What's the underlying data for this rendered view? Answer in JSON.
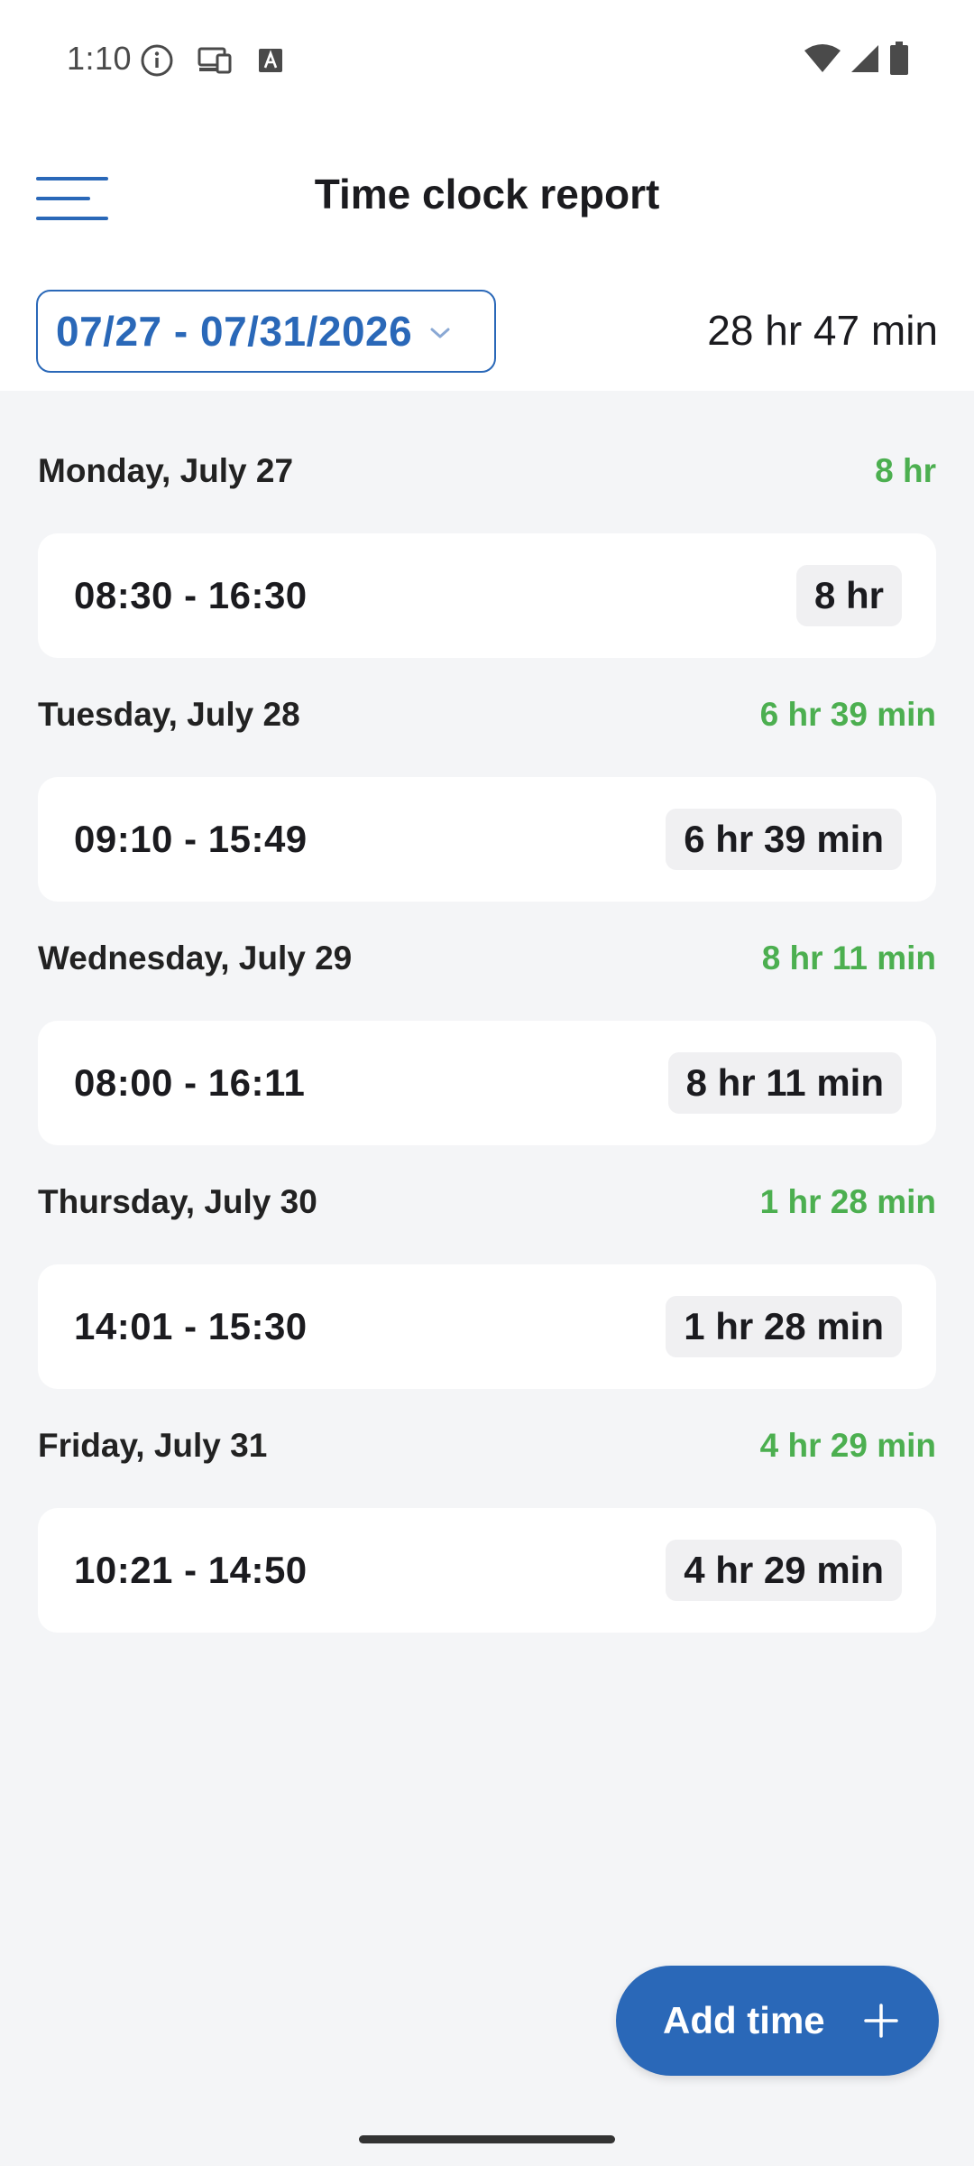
{
  "status_bar": {
    "time": "1:10",
    "left_icons": [
      "info-icon",
      "devices-icon",
      "text-a-icon"
    ],
    "right_icons": [
      "wifi-icon",
      "signal-icon",
      "battery-icon"
    ]
  },
  "header": {
    "title": "Time clock report",
    "menu_icon": "hamburger-menu-icon"
  },
  "range": {
    "label": "07/27 - 07/31/2026",
    "total": "28 hr 47 min"
  },
  "days": [
    {
      "label": "Monday, July 27",
      "total": "8 hr",
      "entry_range": "08:30 - 16:30",
      "entry_duration": "8 hr"
    },
    {
      "label": "Tuesday, July 28",
      "total": "6 hr 39 min",
      "entry_range": "09:10 - 15:49",
      "entry_duration": "6 hr 39 min"
    },
    {
      "label": "Wednesday, July 29",
      "total": "8 hr 11 min",
      "entry_range": "08:00 - 16:11",
      "entry_duration": "8 hr 11 min"
    },
    {
      "label": "Thursday, July 30",
      "total": "1 hr 28 min",
      "entry_range": "14:01 - 15:30",
      "entry_duration": "1 hr 28 min"
    },
    {
      "label": "Friday, July 31",
      "total": "4 hr 29 min",
      "entry_range": "10:21 - 14:50",
      "entry_duration": "4 hr 29 min"
    }
  ],
  "fab": {
    "label": "Add time",
    "icon": "plus-icon"
  },
  "colors": {
    "accent": "#2a68b8",
    "day_total": "#4caf50",
    "background": "#f4f5f7"
  }
}
